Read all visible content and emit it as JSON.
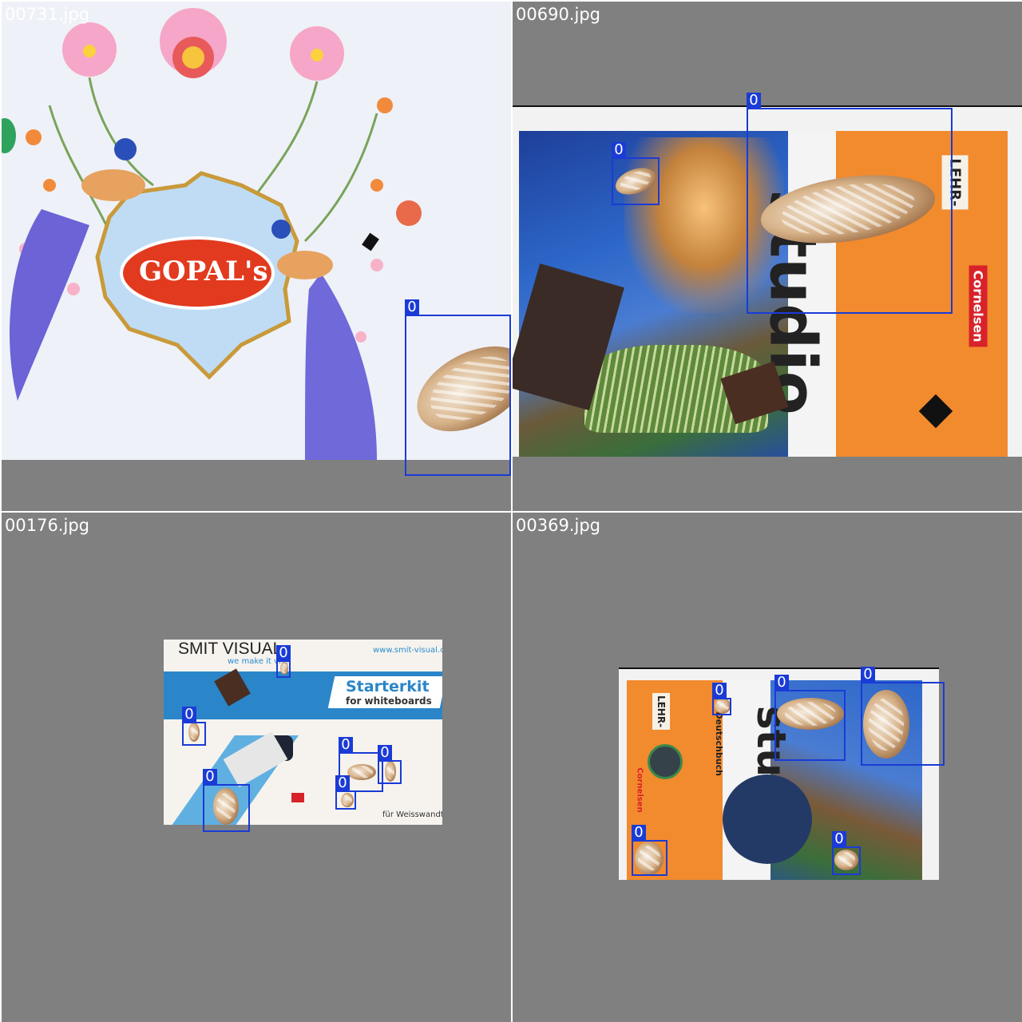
{
  "tiles": [
    {
      "filename": "00731.jpg",
      "photo": {
        "logo_text": "GOPAL's"
      },
      "detections": [
        {
          "label": "0"
        }
      ]
    },
    {
      "filename": "00690.jpg",
      "photo": {
        "book_label": "LEHR-",
        "publisher": "Cornelsen",
        "title_fragment": "studio"
      },
      "detections": [
        {
          "label": "0"
        },
        {
          "label": "0"
        }
      ]
    },
    {
      "filename": "00176.jpg",
      "photo": {
        "brand": "SMIT VISUAL",
        "tagline": "we make it vi...",
        "url": "www.smit-visual.c",
        "banner_title": "Starterkit",
        "banner_sub": "for whiteboards",
        "footer": "für Weisswandta"
      },
      "detections": [
        {
          "label": "0"
        },
        {
          "label": "0"
        },
        {
          "label": "0"
        },
        {
          "label": "0"
        },
        {
          "label": "0"
        },
        {
          "label": "0"
        }
      ]
    },
    {
      "filename": "00369.jpg",
      "photo": {
        "book_label": "LEHR-",
        "publisher": "Cornelsen",
        "subtitle": "s Deutschbuch",
        "title_fragment": "studi"
      },
      "detections": [
        {
          "label": "0"
        },
        {
          "label": "0"
        },
        {
          "label": "0"
        },
        {
          "label": "0"
        },
        {
          "label": "0"
        }
      ]
    }
  ],
  "colors": {
    "box": "#1a3bd6",
    "padding": "#808080",
    "label_text": "#ffffff"
  }
}
